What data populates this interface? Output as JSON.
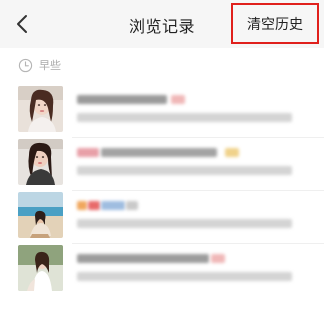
{
  "header": {
    "back_icon": "chevron-left-icon",
    "title": "浏览记录",
    "clear_label": "清空历史",
    "clear_highlight_color": "#e0201c"
  },
  "section": {
    "icon": "clock-icon",
    "label": "早些"
  },
  "items_note_color": "#f2f2f2"
}
